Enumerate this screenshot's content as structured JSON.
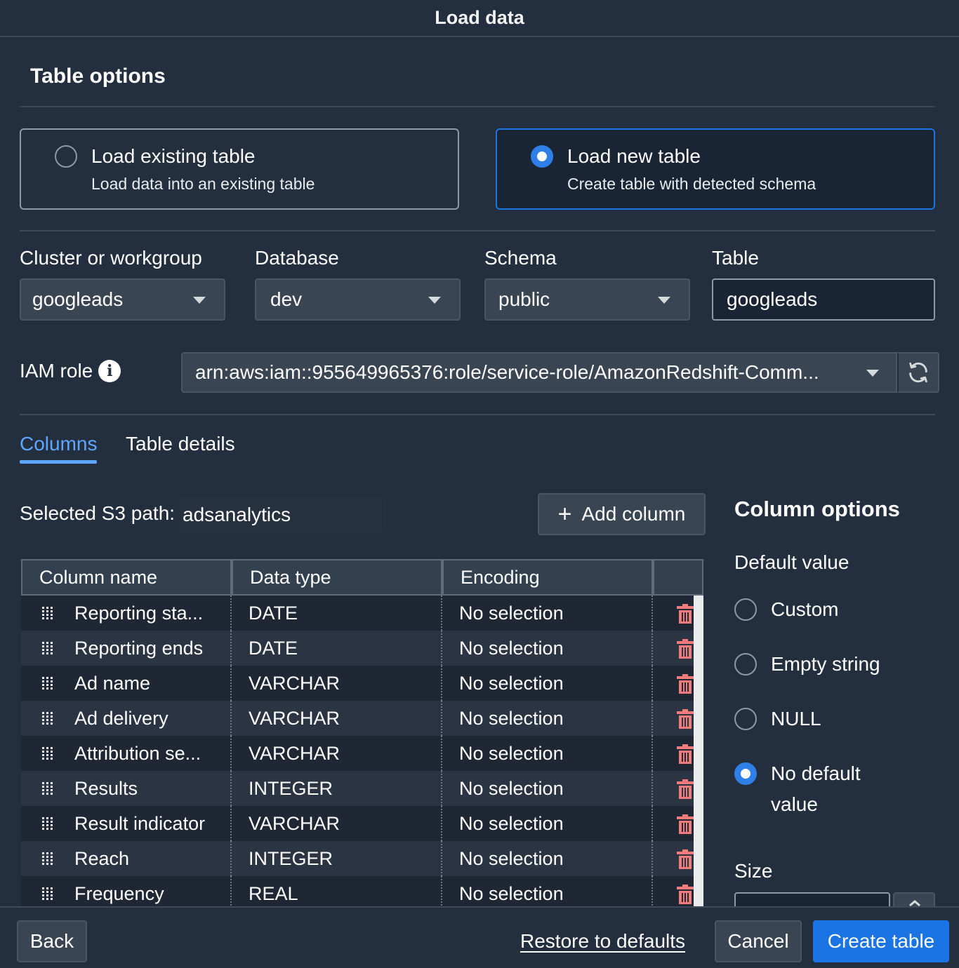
{
  "window": {
    "title": "Load data"
  },
  "table_options": {
    "title": "Table options",
    "options": [
      {
        "title": "Load existing table",
        "description": "Load data into an existing table",
        "selected": false
      },
      {
        "title": "Load new table",
        "description": "Create table with detected schema",
        "selected": true
      }
    ]
  },
  "fields": {
    "cluster": {
      "label": "Cluster or workgroup",
      "value": "googleads"
    },
    "database": {
      "label": "Database",
      "value": "dev"
    },
    "schema": {
      "label": "Schema",
      "value": "public"
    },
    "table": {
      "label": "Table",
      "value": "googleads"
    },
    "iam_role": {
      "label": "IAM role",
      "info": "i",
      "value": "arn:aws:iam::955649965376:role/service-role/AmazonRedshift-Comm..."
    }
  },
  "tabs": [
    {
      "label": "Columns",
      "active": true
    },
    {
      "label": "Table details",
      "active": false
    }
  ],
  "columns_panel": {
    "s3_label": "Selected S3 path:",
    "s3_value": "adsanalytics",
    "add_column_label": "Add column",
    "headers": [
      "Column name",
      "Data type",
      "Encoding",
      ""
    ],
    "rows": [
      {
        "name": "Reporting sta...",
        "type": "DATE",
        "encoding": "No selection"
      },
      {
        "name": "Reporting ends",
        "type": "DATE",
        "encoding": "No selection"
      },
      {
        "name": "Ad name",
        "type": "VARCHAR",
        "encoding": "No selection"
      },
      {
        "name": "Ad delivery",
        "type": "VARCHAR",
        "encoding": "No selection"
      },
      {
        "name": "Attribution se...",
        "type": "VARCHAR",
        "encoding": "No selection"
      },
      {
        "name": "Results",
        "type": "INTEGER",
        "encoding": "No selection"
      },
      {
        "name": "Result indicator",
        "type": "VARCHAR",
        "encoding": "No selection"
      },
      {
        "name": "Reach",
        "type": "INTEGER",
        "encoding": "No selection"
      },
      {
        "name": "Frequency",
        "type": "REAL",
        "encoding": "No selection"
      }
    ]
  },
  "column_options": {
    "title": "Column options",
    "default_value_label": "Default value",
    "choices": [
      {
        "label": "Custom",
        "selected": false
      },
      {
        "label": "Empty string",
        "selected": false
      },
      {
        "label": "NULL",
        "selected": false
      },
      {
        "label": "No default value",
        "selected": true
      }
    ],
    "size_label": "Size"
  },
  "footer": {
    "back": "Back",
    "restore": "Restore to defaults",
    "cancel": "Cancel",
    "create": "Create table"
  },
  "colors": {
    "background": "#232f3e",
    "accent": "#1b74e4",
    "link_active": "#5ea7ff",
    "danger": "#f27c7c"
  },
  "icons": [
    "info-icon",
    "chevron-down-icon",
    "refresh-icon",
    "plus-icon",
    "drag-handle-icon",
    "trash-icon",
    "chevron-up-icon"
  ]
}
